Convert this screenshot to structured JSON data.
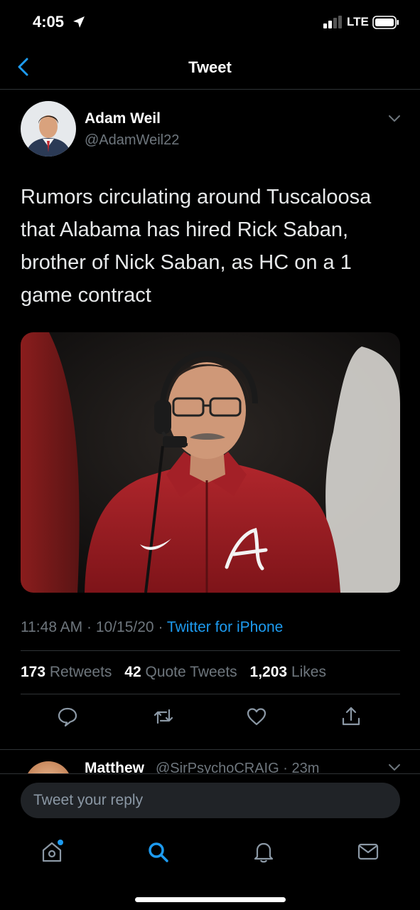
{
  "status_bar": {
    "time": "4:05",
    "network": "LTE"
  },
  "nav": {
    "title": "Tweet"
  },
  "tweet": {
    "author_name": "Adam Weil",
    "author_handle": "@AdamWeil22",
    "text": "Rumors circulating around Tuscaloosa that Alabama has hired Rick Saban, brother of Nick Saban, as HC on a 1 game contract",
    "time": "11:48 AM",
    "separator": "·",
    "date": "10/15/20",
    "source": "Twitter for iPhone",
    "retweets_count": "173",
    "retweets_label": "Retweets",
    "quote_count": "42",
    "quote_label": "Quote Tweets",
    "likes_count": "1,203",
    "likes_label": "Likes"
  },
  "reply_preview": {
    "name": "Matthew",
    "handle_time": "@SirPsychoCRAIG · 23m"
  },
  "composer": {
    "placeholder": "Tweet your reply"
  },
  "icons": {
    "back": "chevron-left-icon",
    "more": "chevron-down-icon",
    "reply": "comment-icon",
    "retweet": "retweet-icon",
    "like": "heart-icon",
    "share": "share-icon",
    "home": "home-icon",
    "search": "search-icon",
    "notifications": "bell-icon",
    "messages": "mail-icon"
  },
  "colors": {
    "accent": "#1d9bf0",
    "background": "#000000",
    "muted": "#6e767d"
  }
}
